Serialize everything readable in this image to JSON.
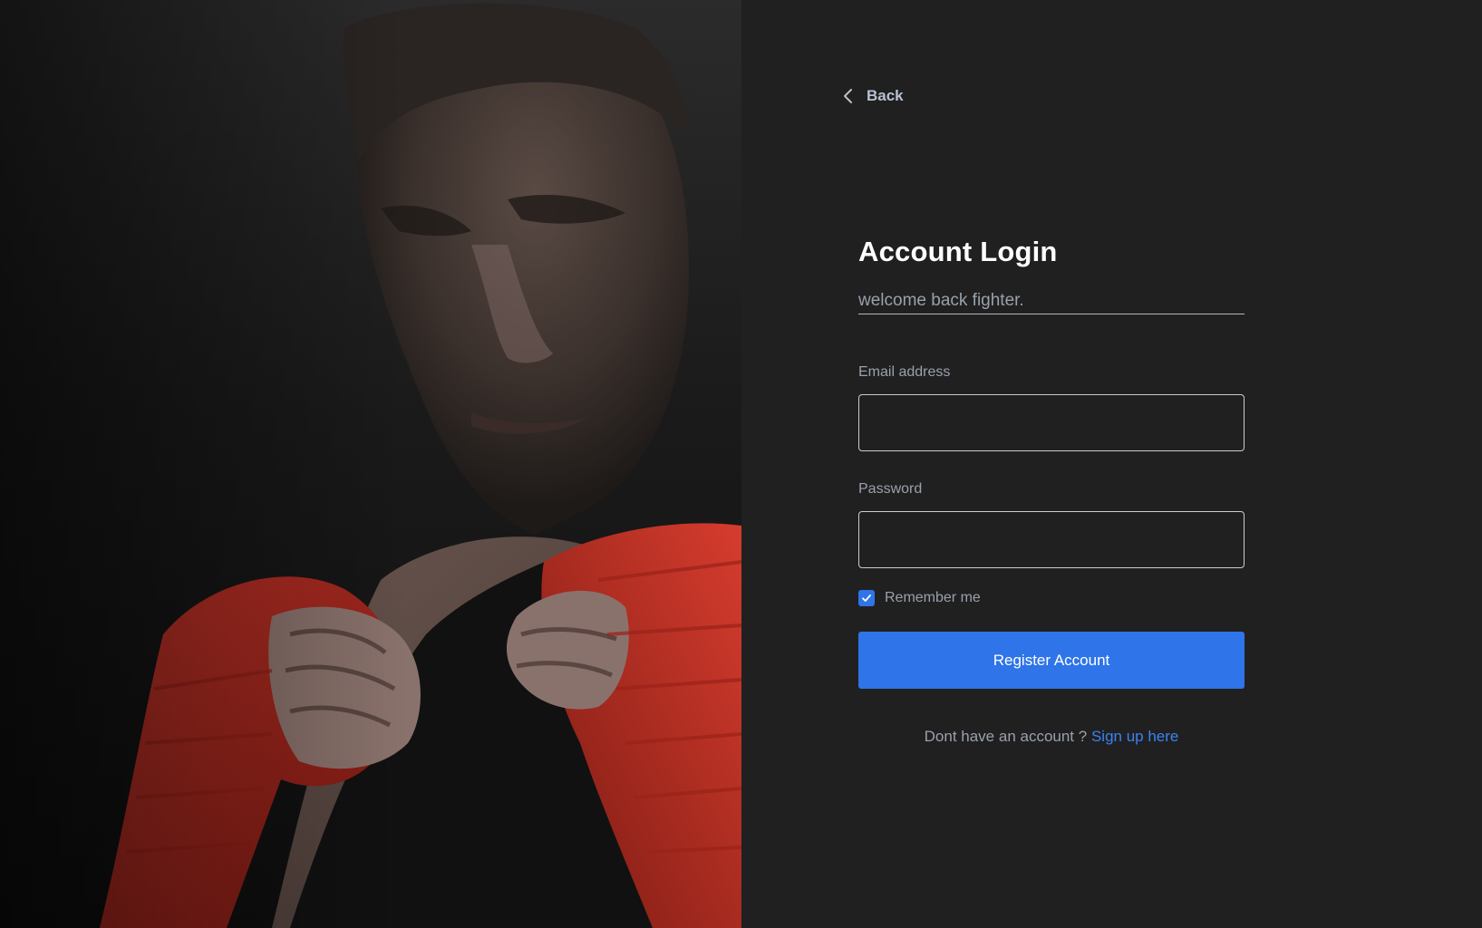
{
  "back": {
    "label": "Back"
  },
  "form": {
    "title": "Account Login",
    "subtitle": "welcome back fighter.",
    "email": {
      "label": "Email address",
      "value": "",
      "placeholder": ""
    },
    "password": {
      "label": "Password",
      "value": "",
      "placeholder": ""
    },
    "remember": {
      "label": "Remember me",
      "checked": true
    },
    "submit_label": "Register Account",
    "signup_prompt": "Dont have an account ?",
    "signup_link": "Sign up here"
  },
  "colors": {
    "panel_bg": "#202021",
    "accent": "#2f74e8",
    "link": "#3b82f0",
    "muted_text": "#9aa0aa",
    "wrap_red": "#b8281d"
  },
  "icons": {
    "back": "chevron-left-icon",
    "checkbox": "check-icon",
    "hero": "boxer-photo"
  }
}
